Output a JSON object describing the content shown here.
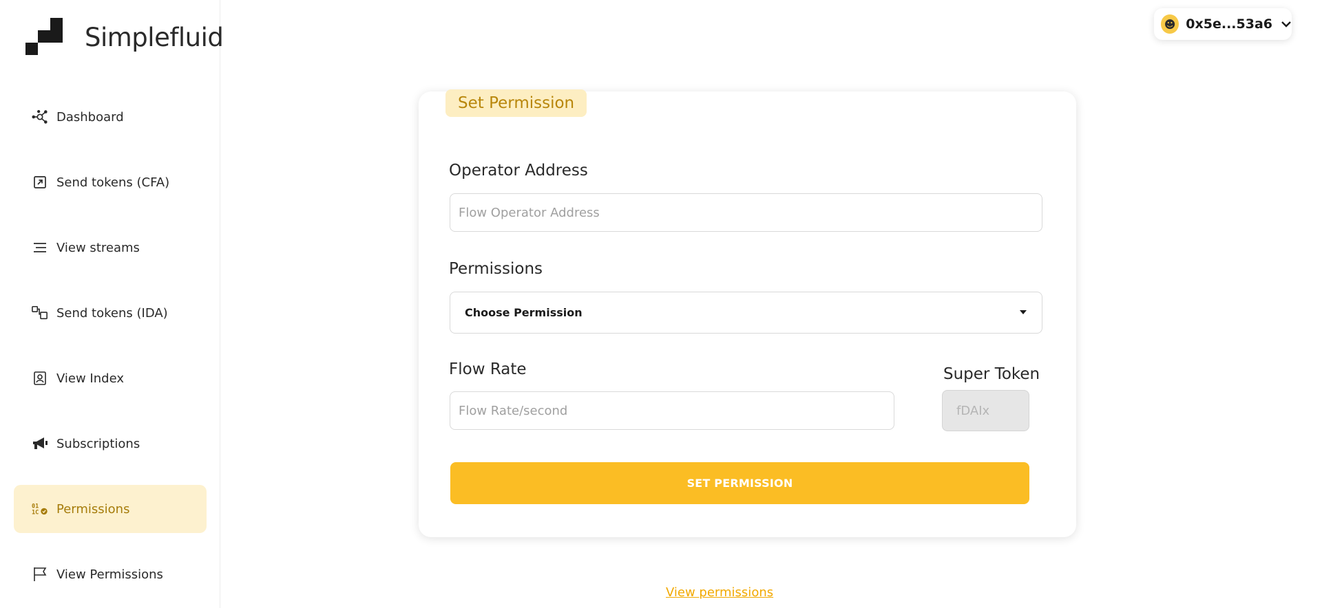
{
  "brand": {
    "name": "Simplefluid"
  },
  "sidebar": {
    "items": [
      {
        "label": "Dashboard",
        "icon": "dashboard-icon"
      },
      {
        "label": "Send tokens (CFA)",
        "icon": "send-arrow-icon"
      },
      {
        "label": "View streams",
        "icon": "list-icon"
      },
      {
        "label": "Send tokens (IDA)",
        "icon": "distribute-icon"
      },
      {
        "label": "View Index",
        "icon": "contact-card-icon"
      },
      {
        "label": "Subscriptions",
        "icon": "megaphone-icon"
      },
      {
        "label": "Permissions",
        "icon": "binary-check-icon",
        "active": true
      },
      {
        "label": "View Permissions",
        "icon": "flag-icon"
      }
    ]
  },
  "wallet": {
    "address": "0x5e...53a6",
    "avatar_icon": "smiley-icon"
  },
  "form": {
    "tag": "Set Permission",
    "operator_label": "Operator Address",
    "operator_placeholder": "Flow Operator Address",
    "permissions_label": "Permissions",
    "permissions_value": "Choose Permission",
    "flow_rate_label": "Flow Rate",
    "flow_rate_placeholder": "Flow Rate/second",
    "super_token_label": "Super Token",
    "super_token_value": "fDAIx",
    "submit_label": "SET PERMISSION"
  },
  "footer": {
    "link": "View permissions"
  },
  "colors": {
    "accent": "#fbbd24",
    "active_bg": "#fdf1cf",
    "active_text": "#a67c0b",
    "link": "#f2a900"
  }
}
